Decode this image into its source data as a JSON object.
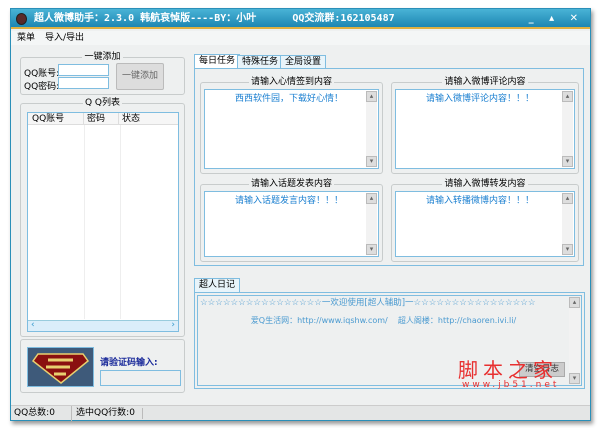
{
  "title": "超人微博助手：2.3.0 韩航哀悼版----BY：小叶      QQ交流群:162105487",
  "window_controls": "_ ▴ ✕",
  "menu": [
    "菜单",
    "导入/导出"
  ],
  "quick_add": {
    "legend": "一键添加",
    "account_label": "QQ账号:",
    "password_label": "QQ密码:",
    "account_value": "",
    "password_value": "",
    "button": "一键添加"
  },
  "qq_list": {
    "legend": "Q Q列表",
    "columns": [
      "QQ账号",
      "密码",
      "状态"
    ]
  },
  "captcha": {
    "label": "请验证码输入:",
    "value": ""
  },
  "status": {
    "total": "QQ总数:0",
    "selected": "选中QQ行数:0"
  },
  "tabs": [
    "每日任务",
    "特殊任务",
    "全局设置"
  ],
  "groups": [
    {
      "legend": "请输入心情签到内容",
      "text": "西西软件园，下载好心情！"
    },
    {
      "legend": "请输入微博评论内容",
      "text": "请输入微博评论内容！！！"
    },
    {
      "legend": "请输入话题发表内容",
      "text": "请输入话题发言内容！！！"
    },
    {
      "legend": "请输入微博转发内容",
      "text": "请输入转播微博内容！！！"
    }
  ],
  "log": {
    "tab": "超人日记",
    "line1": "☆☆☆☆☆☆☆☆☆☆☆☆☆☆☆☆一欢迎使用[超人辅助]一☆☆☆☆☆☆☆☆☆☆☆☆☆☆☆☆",
    "line2": "爱Q生活网：http://www.iqshw.com/    超人阁楼：http://chaoren.ivi.li/",
    "clear_button": "清空日志"
  },
  "watermark": {
    "text": "脚本之家",
    "url": "www.jb51.net"
  }
}
